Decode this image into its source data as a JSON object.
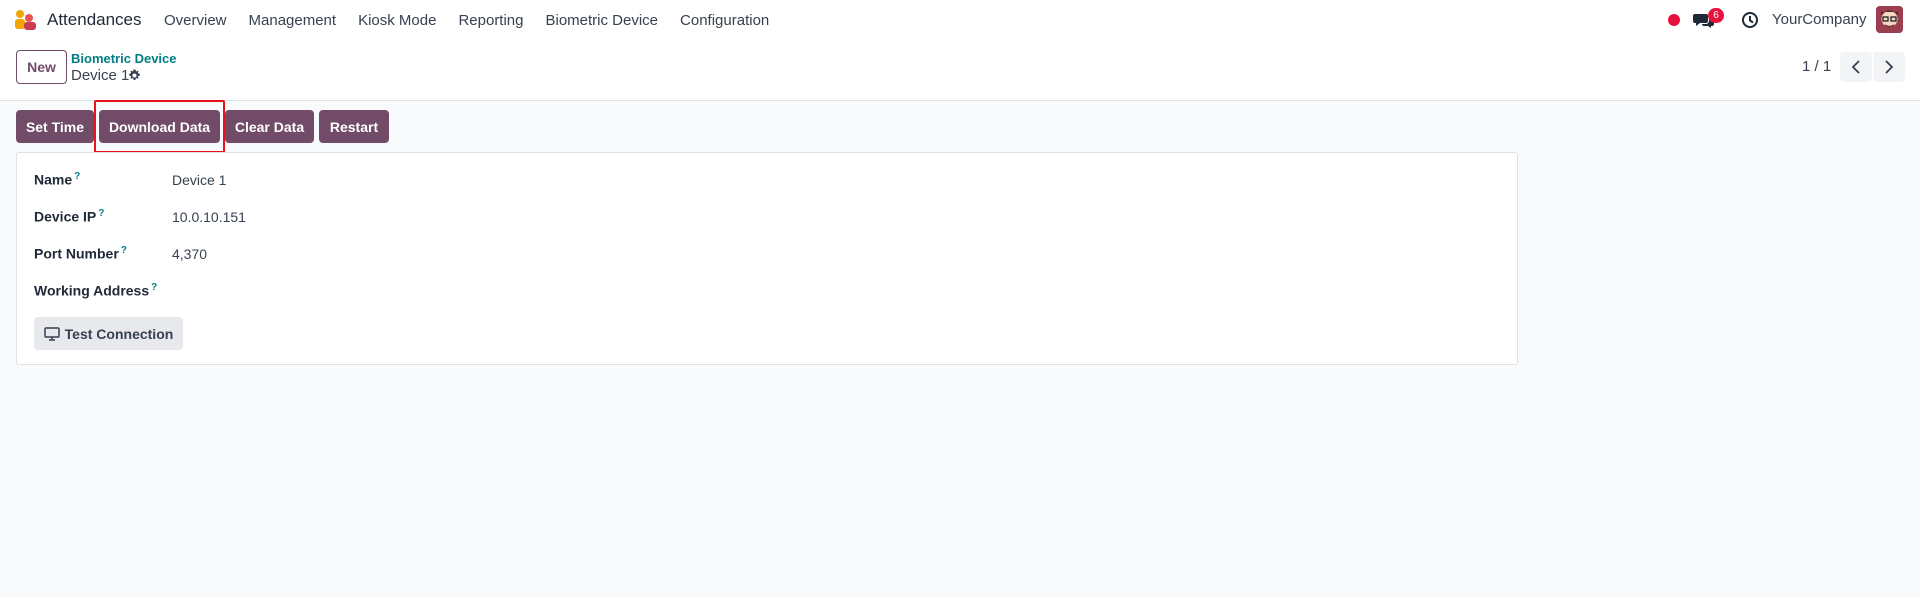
{
  "navbar": {
    "app_name": "Attendances",
    "menu": [
      "Overview",
      "Management",
      "Kiosk Mode",
      "Reporting",
      "Biometric Device",
      "Configuration"
    ],
    "chat_count": "6",
    "company": "YourCompany",
    "icons": {
      "logo": "attendances-logo-icon",
      "status": "recording-dot-icon",
      "chat": "chat-bubbles-icon",
      "activity": "clock-icon",
      "avatar": "user-avatar"
    }
  },
  "control": {
    "new_label": "New",
    "breadcrumb_parent": "Biometric Device",
    "breadcrumb_current": "Device 1",
    "pager": "1 / 1"
  },
  "actions": {
    "set_time": "Set Time",
    "download_data": "Download Data",
    "clear_data": "Clear Data",
    "restart": "Restart"
  },
  "form": {
    "fields": [
      {
        "label": "Name",
        "help": "?",
        "value": "Device 1"
      },
      {
        "label": "Device IP",
        "help": "?",
        "value": "10.0.10.151"
      },
      {
        "label": "Port Number",
        "help": "?",
        "value": "4,370"
      },
      {
        "label": "Working Address",
        "help": "?",
        "value": ""
      }
    ],
    "test_connection": "Test Connection"
  },
  "colors": {
    "primary": "#714b67",
    "link": "#017e84",
    "badge": "#e6123d",
    "highlight": "#e6121d"
  }
}
